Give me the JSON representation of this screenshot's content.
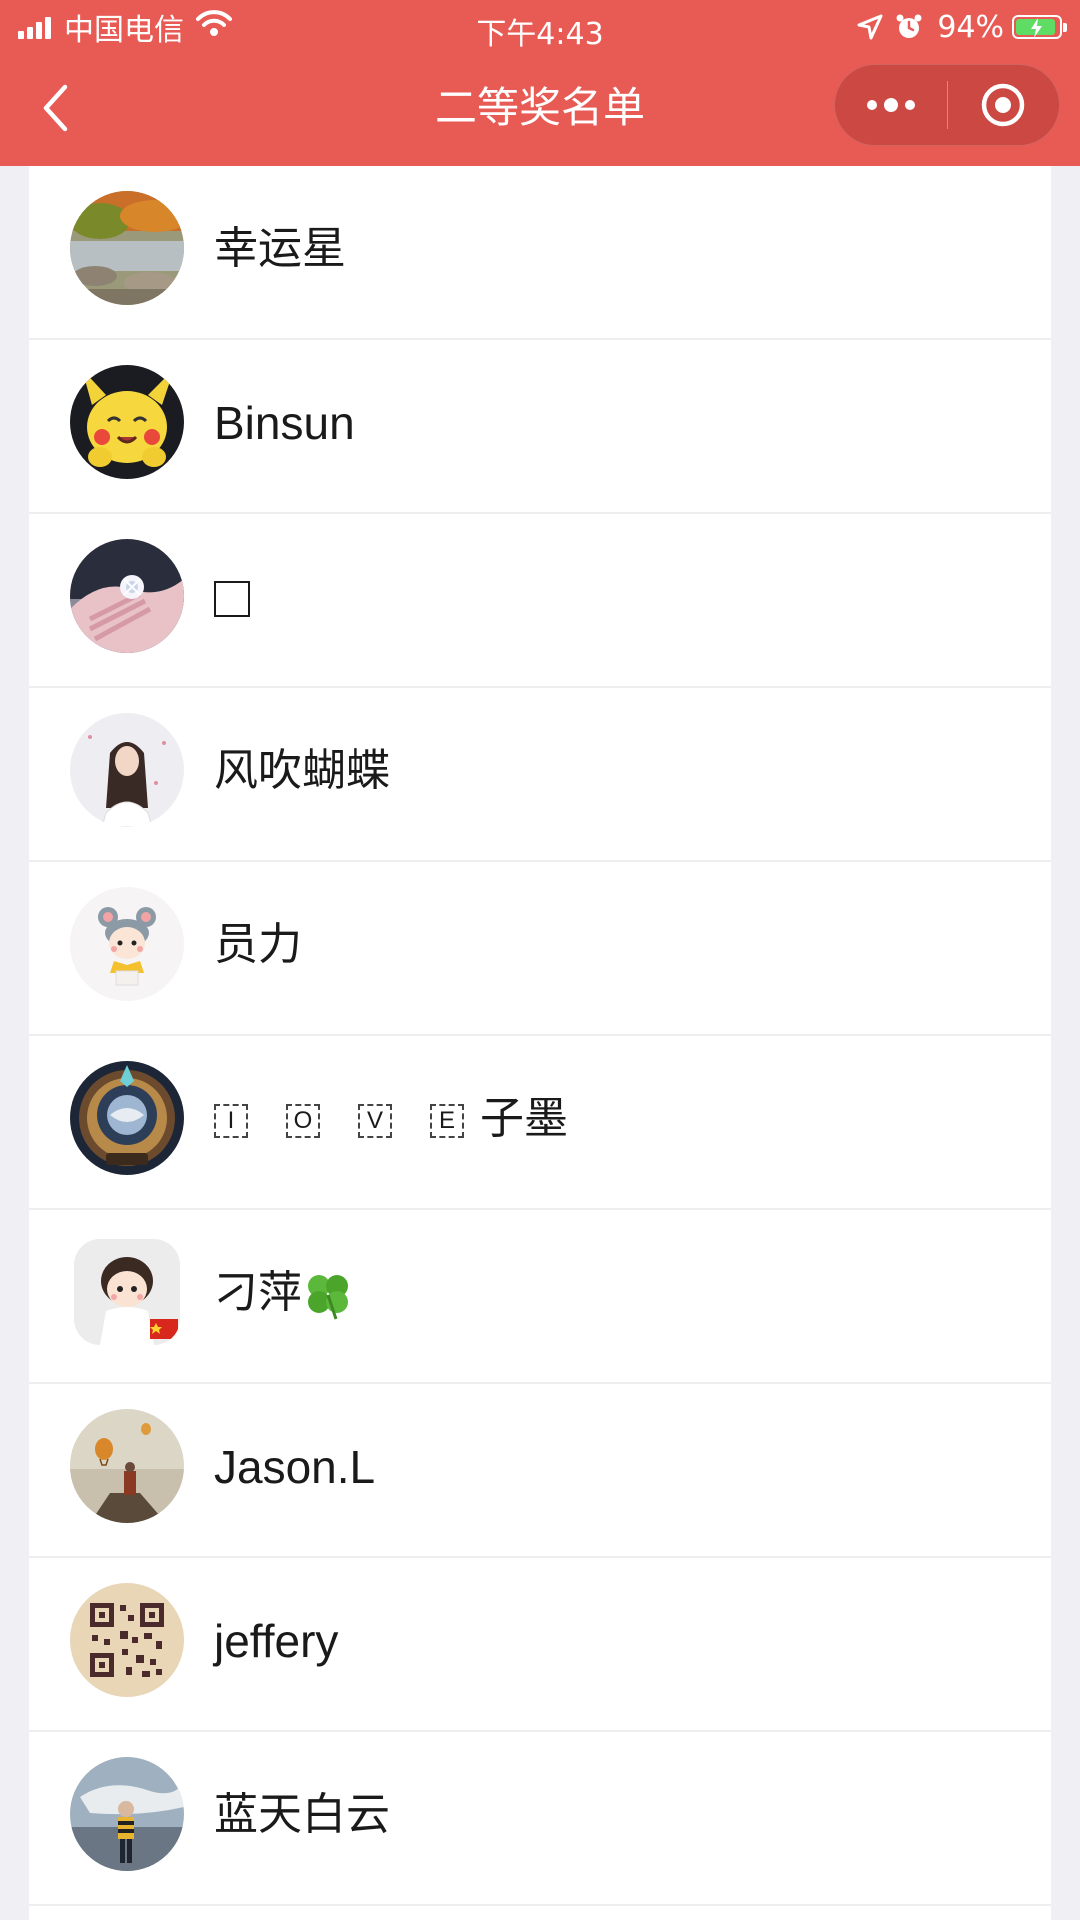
{
  "status_bar": {
    "carrier": "中国电信",
    "time": "下午4:43",
    "battery_percent": "94%",
    "battery_level": 0.94,
    "icons": [
      "signal-icon",
      "wifi-icon",
      "location-arrow-icon",
      "alarm-icon",
      "battery-charging-icon"
    ]
  },
  "navbar": {
    "title": "二等奖名单",
    "back_icon": "chevron-left-icon",
    "more_icon": "more-dots-icon",
    "close_icon": "target-circle-icon"
  },
  "colors": {
    "accent": "#e85a54",
    "background": "#efeff4",
    "row_background": "#ffffff"
  },
  "winners": [
    {
      "name": "幸运星",
      "avatar": "river-landscape"
    },
    {
      "name": "Binsun",
      "avatar": "pikachu-plush"
    },
    {
      "name": "□",
      "avatar": "hand-with-ring"
    },
    {
      "name": "风吹蝴蝶",
      "avatar": "girl-portrait"
    },
    {
      "name": "员力",
      "avatar": "cartoon-mouse-kid"
    },
    {
      "name": "子墨",
      "prefix_glyphs": [
        "I",
        "O",
        "V",
        "E"
      ],
      "avatar": "gold-game-badge-2018"
    },
    {
      "name": "刁萍",
      "suffix_emoji": "🍀",
      "avatar": "cartoon-girl-flag"
    },
    {
      "name": "Jason.L",
      "avatar": "balloons-traveler"
    },
    {
      "name": "jeffery",
      "avatar": "qr-code"
    },
    {
      "name": "蓝天白云",
      "avatar": "person-sky"
    }
  ]
}
